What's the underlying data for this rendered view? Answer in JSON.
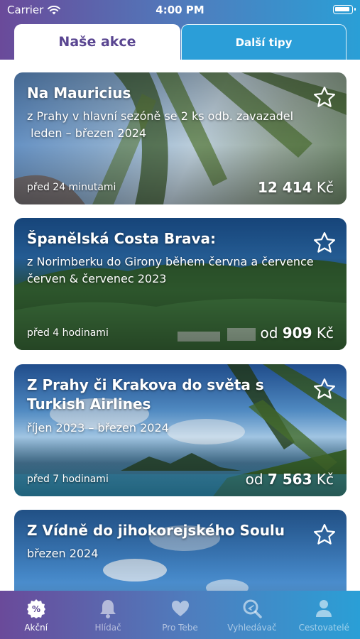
{
  "status": {
    "carrier": "Carrier",
    "time": "4:00 PM"
  },
  "tabs": {
    "active": "Naše akce",
    "inactive": "Další tipy"
  },
  "cards": [
    {
      "title": "Na Mauricius",
      "lines": [
        "z Prahy v hlavní sezóně se 2 ks odb. zavazadel",
        " leden – březen 2024"
      ],
      "time": "před 24 minutami",
      "price_prefix": "",
      "price_value": "12 414",
      "currency": "Kč"
    },
    {
      "title": "Španělská Costa Brava:",
      "lines": [
        "z Norimberku do Girony během června a července",
        "červen & červenec 2023"
      ],
      "time": "před 4 hodinami",
      "price_prefix": "od",
      "price_value": "909",
      "currency": "Kč"
    },
    {
      "title": "Z Prahy či Krakova do světa s Turkish Airlines",
      "lines": [
        "říjen 2023 – březen 2024"
      ],
      "time": "před 7 hodinami",
      "price_prefix": "od",
      "price_value": "7 563",
      "currency": "Kč"
    },
    {
      "title": "Z Vídně do jihokorejského Soulu",
      "lines": [
        "březen 2024"
      ],
      "time": "",
      "price_prefix": "",
      "price_value": "",
      "currency": ""
    }
  ],
  "tabbar": [
    {
      "label": "Akční",
      "icon": "badge-percent-icon",
      "active": true
    },
    {
      "label": "Hlídač",
      "icon": "bell-icon",
      "active": false
    },
    {
      "label": "Pro Tebe",
      "icon": "heart-icon",
      "active": false
    },
    {
      "label": "Vyhledávač",
      "icon": "search-flight-icon",
      "active": false
    },
    {
      "label": "Cestovatelé",
      "icon": "user-icon",
      "active": false
    }
  ],
  "colors": {
    "header_start": "#6a4a9a",
    "header_end": "#2a9fd6",
    "active_tab_text": "#5a4691"
  }
}
